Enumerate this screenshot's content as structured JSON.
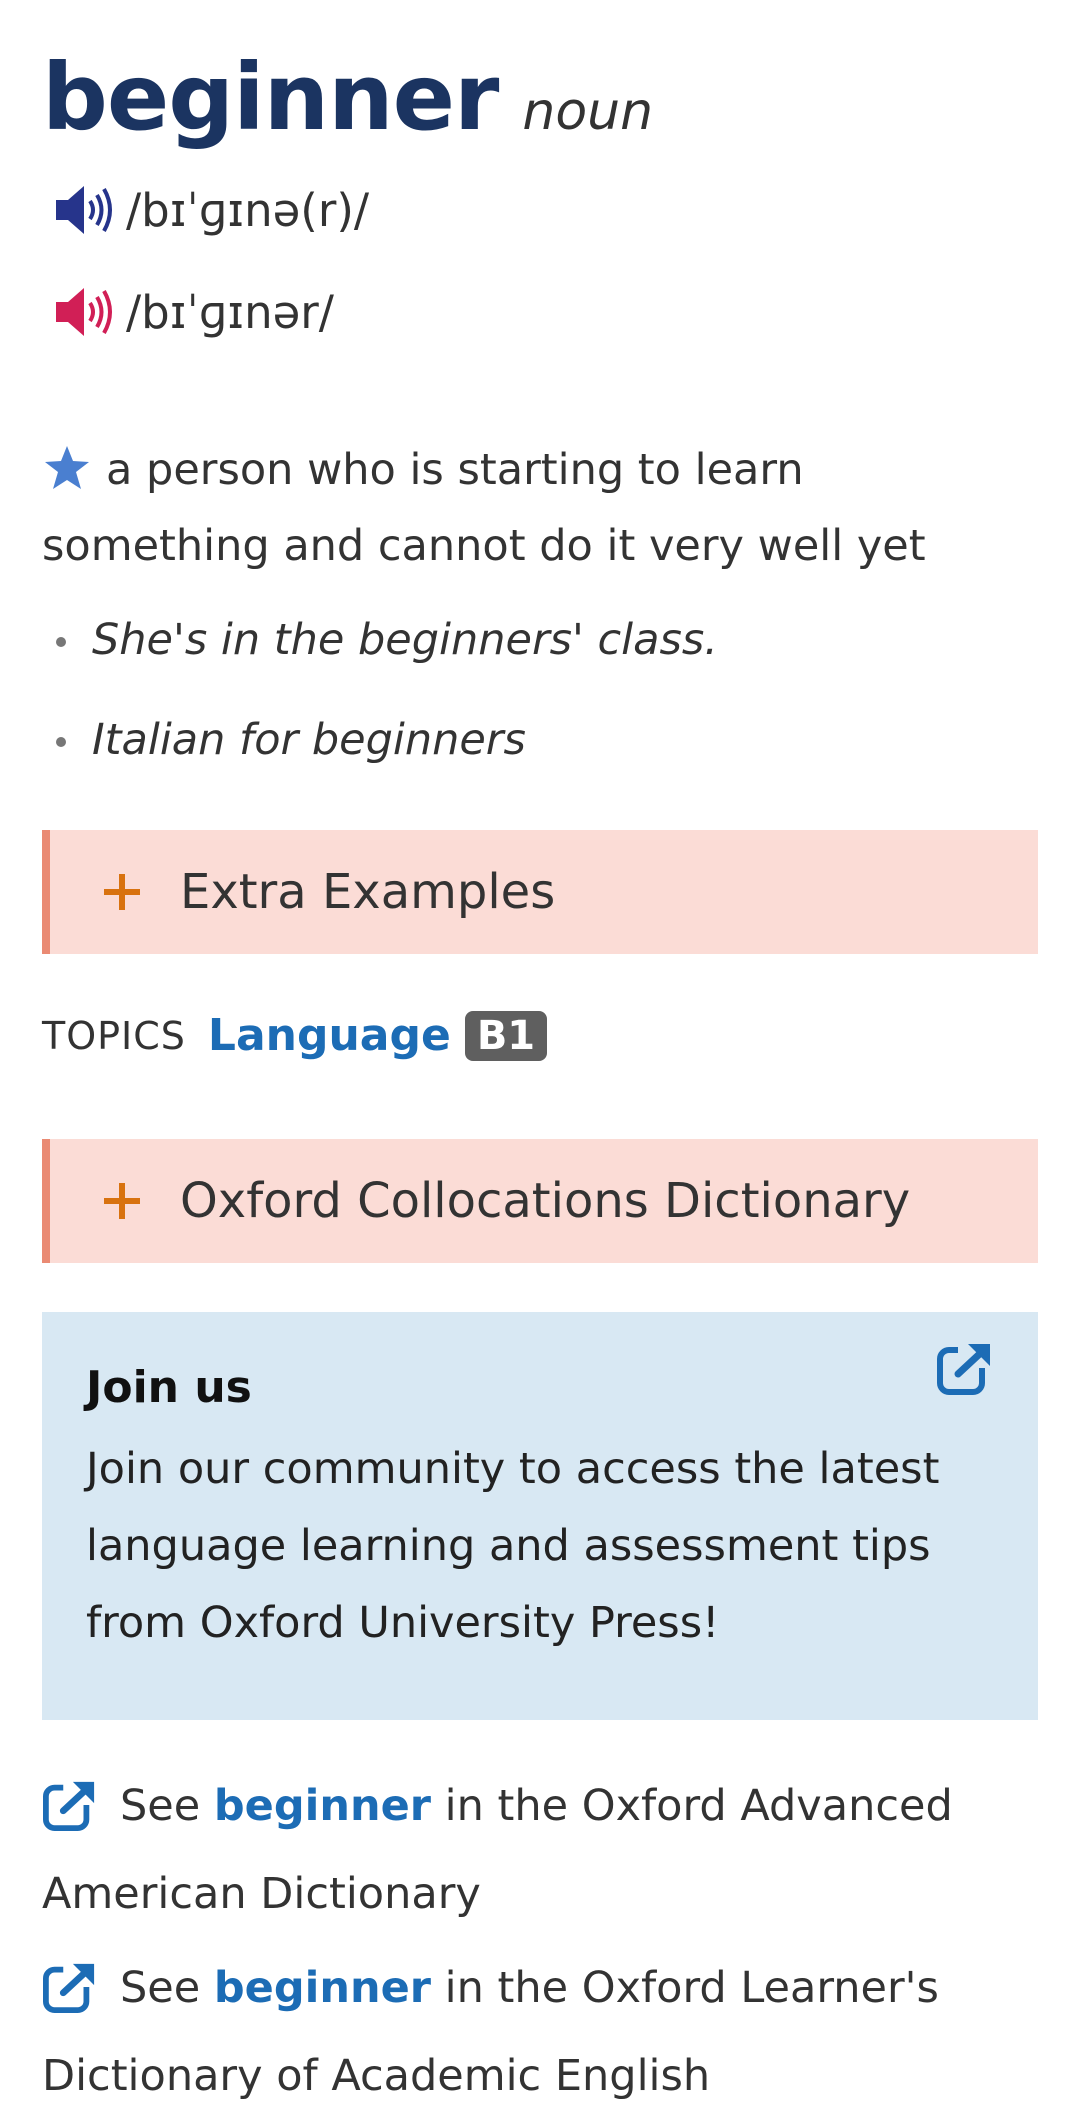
{
  "entry": {
    "headword": "beginner",
    "part_of_speech": "noun",
    "pronunciations": [
      {
        "variant": "British",
        "icon": "speaker-icon",
        "color": "#26348b",
        "ipa": "/bɪˈɡɪnə(r)/"
      },
      {
        "variant": "American",
        "icon": "speaker-icon",
        "color": "#d11f56",
        "ipa": "/bɪˈɡɪnər/"
      }
    ],
    "definition": {
      "icon": "star-icon",
      "text": "a person who is starting to learn something and cannot do it very well yet"
    },
    "examples": [
      "She's in the beginners' class.",
      "Italian for beginners"
    ]
  },
  "extra_examples": {
    "icon": "plus-icon",
    "label": "Extra Examples"
  },
  "topics": {
    "label": "TOPICS",
    "topic": "Language",
    "level": "B1"
  },
  "collocations": {
    "icon": "plus-icon",
    "label": "Oxford Collocations Dictionary"
  },
  "join": {
    "title": "Join us",
    "text": "Join our community to access the latest language learning and assessment tips from Oxford University Press!",
    "icon": "external-link-icon"
  },
  "see_also": [
    {
      "prefix": "See",
      "link": "beginner",
      "suffix": "in the Oxford Advanced American Dictionary"
    },
    {
      "prefix": "See",
      "link": "beginner",
      "suffix": "in the Oxford Learner's Dictionary of Academic English"
    }
  ],
  "colors": {
    "headword": "#1b3461",
    "link": "#1c6cb5",
    "accent_orange": "#d8720f",
    "expander_bg": "#fbdcd6",
    "expander_border": "#ea8a73",
    "join_bg": "#d8e8f3",
    "star": "#4a7fd0"
  }
}
